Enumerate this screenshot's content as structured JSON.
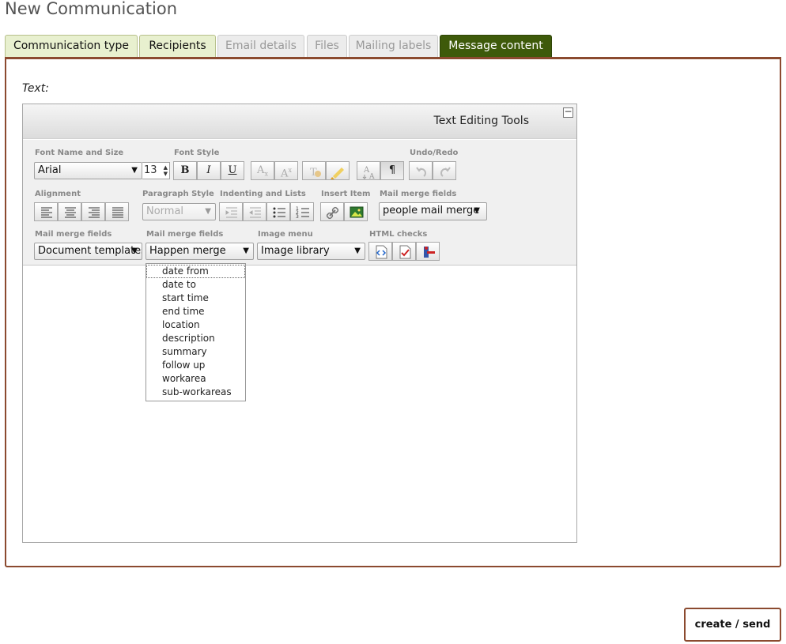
{
  "page": {
    "title": "New Communication"
  },
  "tabs": [
    {
      "label": "Communication type",
      "state": "done"
    },
    {
      "label": "Recipients",
      "state": "done"
    },
    {
      "label": "Email details",
      "state": "disabled"
    },
    {
      "label": "Files",
      "state": "disabled"
    },
    {
      "label": "Mailing labels",
      "state": "disabled"
    },
    {
      "label": "Message content",
      "state": "active"
    }
  ],
  "form": {
    "text_label": "Text:"
  },
  "editor": {
    "header_title": "Text Editing Tools",
    "collapse_glyph": "−",
    "groups": {
      "font": "Font Name and Size",
      "font_style": "Font Style",
      "undo_redo": "Undo/Redo",
      "alignment": "Alignment",
      "paragraph_style": "Paragraph Style",
      "indent_lists": "Indenting and Lists",
      "insert_item": "Insert Item",
      "mail_merge_1": "Mail merge fields",
      "mail_merge_2": "Mail merge fields",
      "mail_merge_3": "Mail merge fields",
      "image_menu": "Image menu",
      "html_checks": "HTML checks"
    },
    "font_name": "Arial",
    "font_size": "13",
    "paragraph_style": "Normal",
    "people_merge": "people mail merge",
    "document_templates": "Document templates",
    "happen_merge": "Happen merge",
    "image_library": "Image library",
    "style_glyphs": {
      "bold": "B",
      "italic": "I",
      "underline": "U",
      "para": "¶"
    }
  },
  "merge_dropdown": {
    "items": [
      "date from",
      "date to",
      "start time",
      "end time",
      "location",
      "description",
      "summary",
      "follow up",
      "workarea",
      "sub-workareas"
    ]
  },
  "actions": {
    "send_label": "create / send"
  },
  "colors": {
    "active_tab": "#3e5a0a",
    "done_tab": "#e8f0cf",
    "panel_border": "#8b4a2f"
  }
}
